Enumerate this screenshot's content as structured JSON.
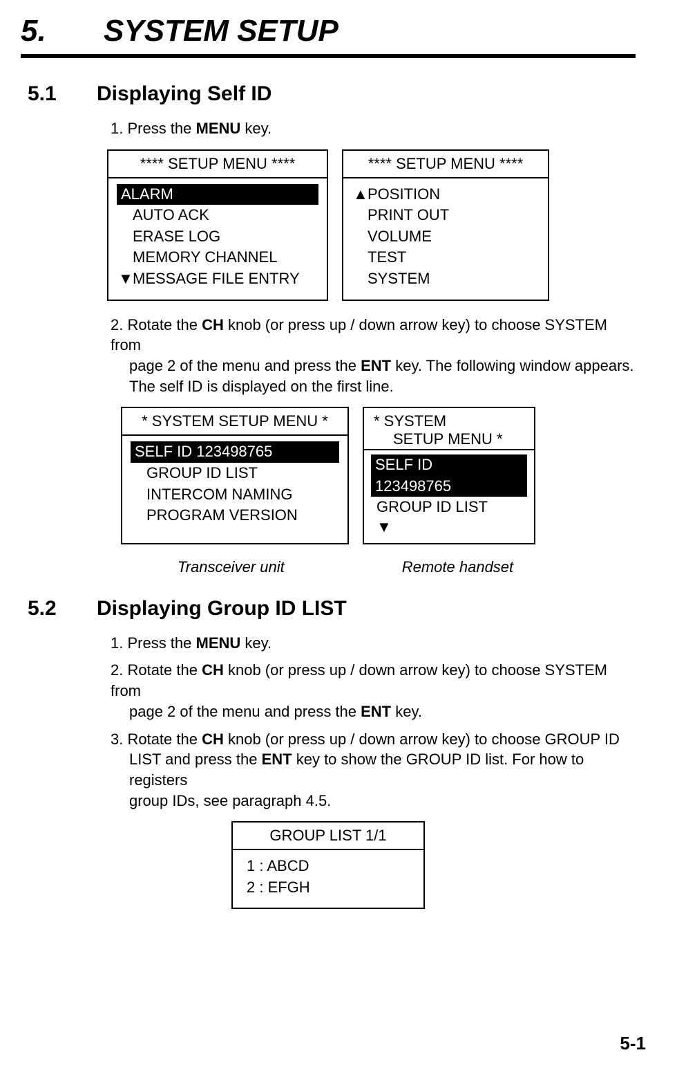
{
  "chapter": {
    "number": "5.",
    "title": "SYSTEM SETUP"
  },
  "section51": {
    "number": "5.1",
    "title": "Displaying Self ID",
    "step1_prefix": "1. Press the ",
    "step1_bold": "MENU",
    "step1_suffix": " key.",
    "step2_a": "2. Rotate the ",
    "step2_b": "CH",
    "step2_c": " knob (or press up / down arrow key) to choose SYSTEM from",
    "step2_d": "page 2 of the menu and press the ",
    "step2_e": "ENT",
    "step2_f": " key. The following window appears.",
    "step2_g": "The self ID is displayed on the first line."
  },
  "setup_menu1": {
    "title": "**** SETUP MENU ****",
    "item1": "ALARM",
    "item2": "AUTO  ACK",
    "item3": "ERASE  LOG",
    "item4": "MEMORY CHANNEL",
    "item5": "MESSAGE FILE ENTRY",
    "down_arrow": "▼"
  },
  "setup_menu2": {
    "title": "**** SETUP MENU ****",
    "up_arrow": "▲",
    "item1": "POSITION",
    "item2": "PRINT OUT",
    "item3": "VOLUME",
    "item4": "TEST",
    "item5": "SYSTEM"
  },
  "system_menu1": {
    "title": "* SYSTEM SETUP MENU *",
    "item1": "SELF ID 123498765",
    "item2": "GROUP ID LIST",
    "item3": "INTERCOM NAMING",
    "item4": "PROGRAM VERSION"
  },
  "system_menu2": {
    "title_l1": "* SYSTEM",
    "title_l2": "SETUP MENU *",
    "item1_l1": "SELF ID",
    "item1_l2": "123498765",
    "item2": "GROUP ID LIST",
    "down_arrow": "▼"
  },
  "captions": {
    "transceiver": "Transceiver unit",
    "remote": "Remote handset"
  },
  "section52": {
    "number": "5.2",
    "title": "Displaying Group ID LIST",
    "step1_prefix": "1. Press the ",
    "step1_bold": "MENU",
    "step1_suffix": " key.",
    "step2_a": "2. Rotate the ",
    "step2_b": "CH",
    "step2_c": " knob (or press up / down arrow key) to choose SYSTEM from",
    "step2_d": "page 2 of the menu and press the ",
    "step2_e": "ENT",
    "step2_f": " key.",
    "step3_a": "3. Rotate the ",
    "step3_b": "CH",
    "step3_c": " knob (or press up / down arrow key) to choose GROUP ID",
    "step3_d": "LIST and press the ",
    "step3_e": "ENT",
    "step3_f": " key to show the GROUP ID list. For how to registers",
    "step3_g": "group IDs, see paragraph 4.5."
  },
  "group_list": {
    "title": "GROUP LIST 1/1",
    "item1": "1 : ABCD",
    "item2": "2 : EFGH"
  },
  "page_number": "5-1"
}
